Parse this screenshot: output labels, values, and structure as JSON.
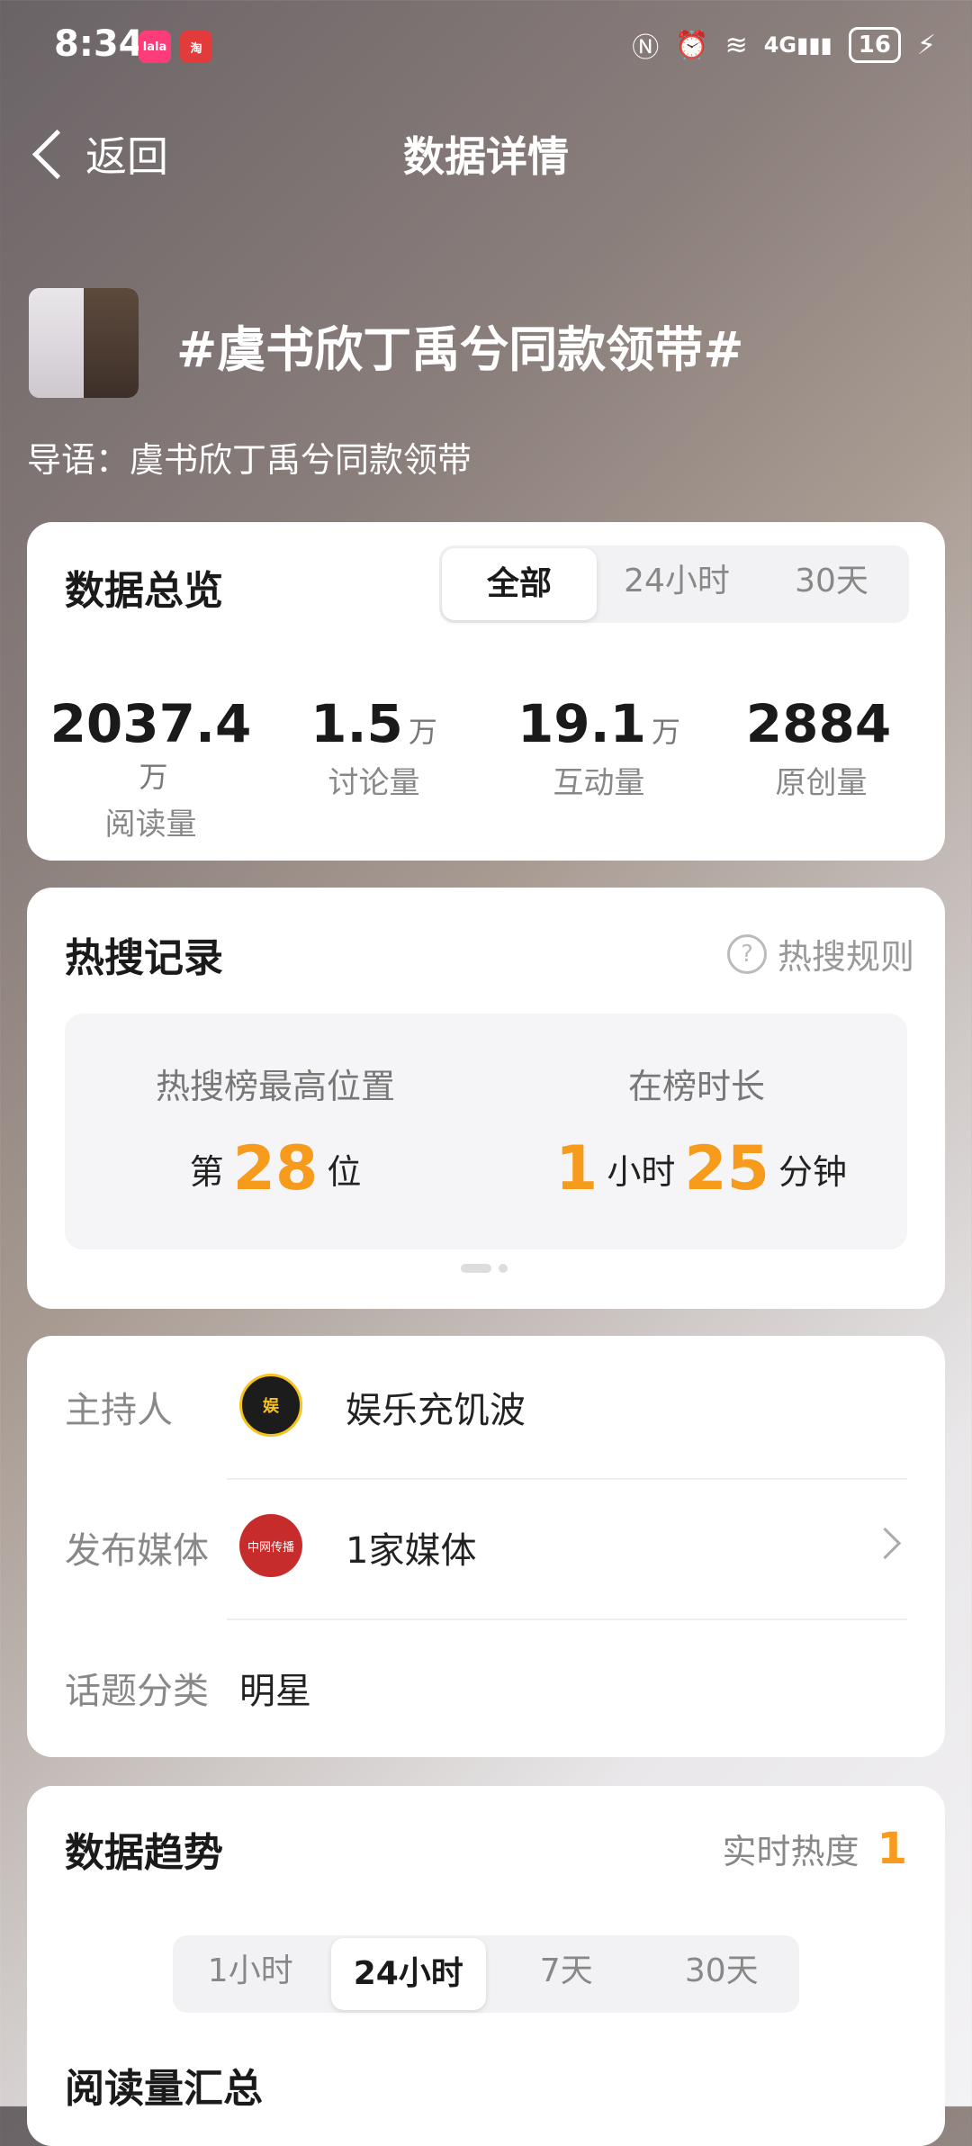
{
  "status_bar": {
    "time": "8:34",
    "signal": "4G",
    "battery": "16"
  },
  "nav": {
    "back_label": "返回",
    "title": "数据详情"
  },
  "topic": {
    "title": "#虞书欣丁禹兮同款领带#",
    "intro": "导语：虞书欣丁禹兮同款领带"
  },
  "overview": {
    "title": "数据总览",
    "tabs": [
      "全部",
      "24小时",
      "30天"
    ],
    "active_tab": "全部",
    "stats": [
      {
        "value": "2037.4",
        "unit": "万",
        "label": "阅读量"
      },
      {
        "value": "1.5",
        "unit": "万",
        "label": "讨论量"
      },
      {
        "value": "19.1",
        "unit": "万",
        "label": "互动量"
      },
      {
        "value": "2884",
        "unit": "",
        "label": "原创量"
      }
    ]
  },
  "hot": {
    "title": "热搜记录",
    "rules": "热搜规则",
    "best_rank_label": "热搜榜最高位置",
    "rank_prefix": "第",
    "rank": "28",
    "rank_suffix": "位",
    "duration_label": "在榜时长",
    "hours": "1",
    "hours_unit": "小时",
    "minutes": "25",
    "minutes_unit": "分钟"
  },
  "info": {
    "host_label": "主持人",
    "host_name": "娱乐充饥波",
    "media_label": "发布媒体",
    "media_value": "1家媒体",
    "media_icon_text": "中网传播",
    "category_label": "话题分类",
    "category_value": "明星"
  },
  "trend": {
    "title": "数据趋势",
    "realtime_label": "实时热度",
    "realtime_value": "1",
    "tabs": [
      "1小时",
      "24小时",
      "7天",
      "30天"
    ],
    "active_tab": "24小时",
    "partial_label": "阅读量汇总"
  },
  "colors": {
    "accent_orange": "#f79b1c"
  }
}
